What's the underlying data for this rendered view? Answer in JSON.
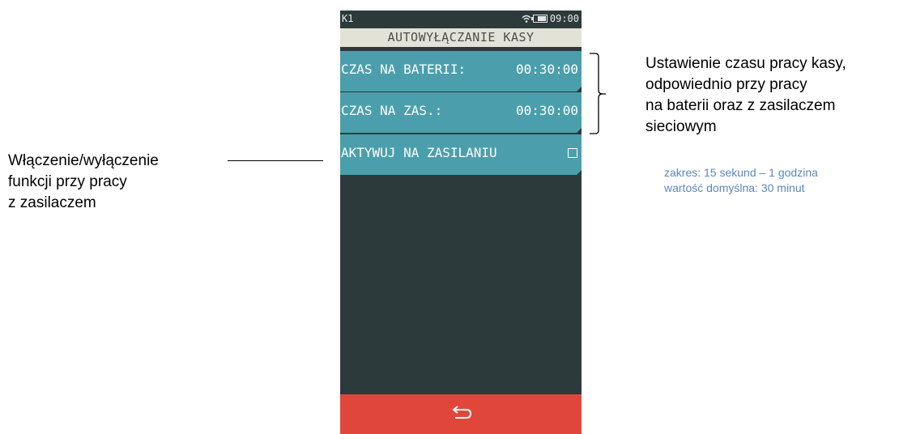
{
  "status": {
    "left": "K1",
    "time": "09:00"
  },
  "screen_title": "AUTOWYŁĄCZANIE KASY",
  "rows": [
    {
      "label": "CZAS NA BATERII:",
      "value": "00:30:00"
    },
    {
      "label": "CZAS NA ZAS.:",
      "value": "00:30:00"
    },
    {
      "label": "AKTYWUJ NA ZASILANIU",
      "checked": false
    }
  ],
  "annotations": {
    "right": [
      "Ustawienie czasu pracy kasy,",
      "odpowiednio przy pracy",
      "na baterii oraz z zasilaczem",
      "sieciowym"
    ],
    "range": [
      "zakres: 15 sekund – 1 godzina",
      "wartość domyślna: 30 minut"
    ],
    "left": [
      "Włączenie/wyłączenie",
      "funkcji przy pracy",
      "z zasilaczem"
    ]
  },
  "colors": {
    "screen_bg": "#2c3a3b",
    "row_bg": "#4b9fad",
    "title_bg": "#e3e2d7",
    "back_bar": "#e0473a",
    "note_blue": "#5b86c2"
  },
  "icons": [
    "wifi-icon",
    "battery-icon",
    "checkbox",
    "back-arrow-icon"
  ]
}
